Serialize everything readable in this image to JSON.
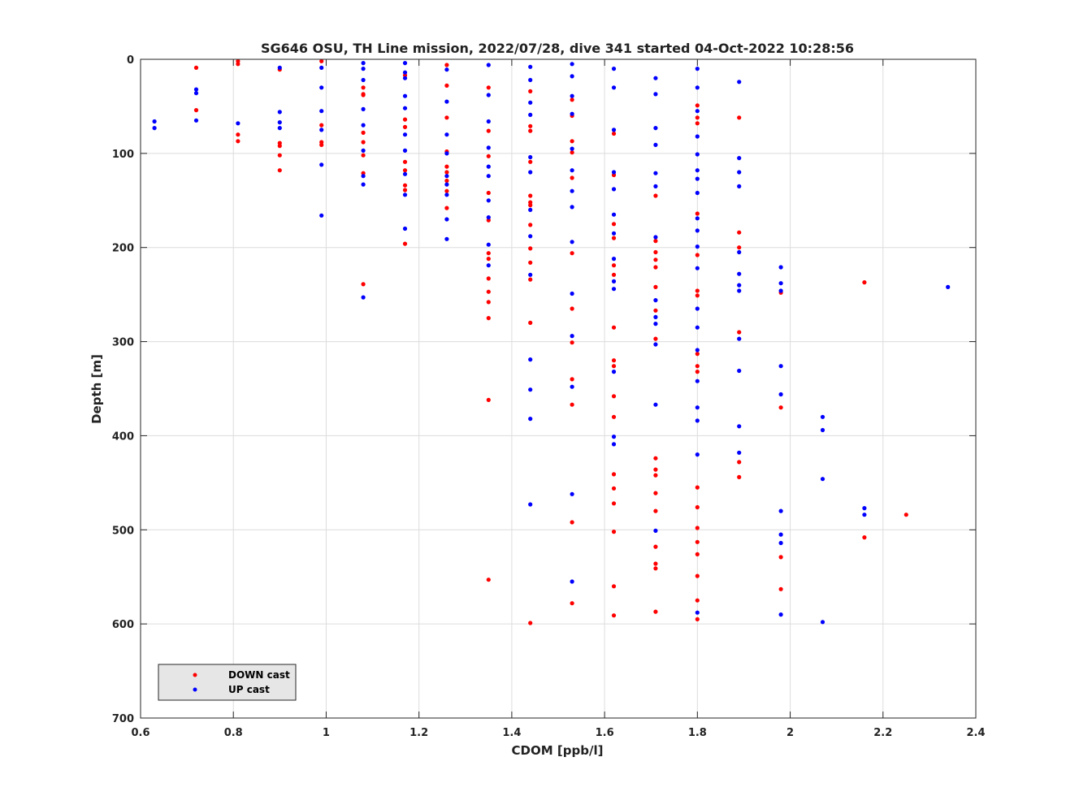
{
  "chart_data": {
    "type": "scatter",
    "title": "SG646 OSU, TH Line mission, 2022/07/28, dive 341 started 04-Oct-2022 10:28:56",
    "xlabel": "CDOM [ppb/l]",
    "ylabel": "Depth [m]",
    "xlim": [
      0.6,
      2.4
    ],
    "ylim": [
      0,
      700
    ],
    "y_reversed": true,
    "grid": true,
    "xticks": [
      0.6,
      0.8,
      1,
      1.2,
      1.4,
      1.6,
      1.8,
      2,
      2.2,
      2.4
    ],
    "xtick_labels": [
      "0.6",
      "0.8",
      "1",
      "1.2",
      "1.4",
      "1.6",
      "1.8",
      "2",
      "2.2",
      "2.4"
    ],
    "yticks": [
      0,
      100,
      200,
      300,
      400,
      500,
      600,
      700
    ],
    "ytick_labels": [
      "0",
      "100",
      "200",
      "300",
      "400",
      "500",
      "600",
      "700"
    ],
    "legend_position": "bottom-left",
    "series": [
      {
        "name": "DOWN cast",
        "color": "#ff0000",
        "x": [
          0.72,
          0.72,
          0.81,
          0.81,
          0.81,
          0.81,
          0.9,
          0.9,
          0.9,
          0.9,
          0.9,
          0.99,
          0.99,
          0.99,
          0.99,
          1.08,
          1.08,
          1.08,
          1.08,
          1.08,
          1.08,
          1.08,
          1.08,
          1.17,
          1.17,
          1.17,
          1.17,
          1.17,
          1.17,
          1.17,
          1.17,
          1.26,
          1.26,
          1.26,
          1.26,
          1.26,
          1.26,
          1.26,
          1.26,
          1.26,
          1.35,
          1.35,
          1.35,
          1.35,
          1.35,
          1.35,
          1.35,
          1.35,
          1.35,
          1.35,
          1.35,
          1.35,
          1.35,
          1.44,
          1.44,
          1.44,
          1.44,
          1.44,
          1.44,
          1.44,
          1.44,
          1.44,
          1.44,
          1.44,
          1.44,
          1.44,
          1.53,
          1.53,
          1.53,
          1.53,
          1.53,
          1.53,
          1.53,
          1.53,
          1.53,
          1.53,
          1.53,
          1.53,
          1.62,
          1.62,
          1.62,
          1.62,
          1.62,
          1.62,
          1.62,
          1.62,
          1.62,
          1.62,
          1.62,
          1.62,
          1.62,
          1.62,
          1.62,
          1.62,
          1.62,
          1.71,
          1.71,
          1.71,
          1.71,
          1.71,
          1.71,
          1.71,
          1.71,
          1.71,
          1.71,
          1.71,
          1.71,
          1.71,
          1.71,
          1.71,
          1.71,
          1.71,
          1.8,
          1.8,
          1.8,
          1.8,
          1.8,
          1.8,
          1.8,
          1.8,
          1.8,
          1.8,
          1.8,
          1.8,
          1.8,
          1.8,
          1.8,
          1.8,
          1.8,
          1.8,
          1.89,
          1.89,
          1.89,
          1.89,
          1.89,
          1.89,
          1.98,
          1.98,
          1.98,
          1.98,
          2.16,
          2.16,
          2.25
        ],
        "y": [
          9,
          54,
          2,
          5,
          80,
          87,
          11,
          89,
          92,
          102,
          118,
          2,
          70,
          88,
          91,
          30,
          38,
          78,
          88,
          102,
          121,
          239,
          37,
          64,
          72,
          109,
          118,
          134,
          139,
          196,
          17,
          28,
          62,
          98,
          114,
          120,
          129,
          140,
          158,
          6,
          30,
          76,
          142,
          171,
          206,
          212,
          233,
          247,
          258,
          275,
          362,
          553,
          103,
          34,
          71,
          109,
          145,
          155,
          176,
          201,
          216,
          234,
          280,
          599,
          152,
          76,
          126,
          206,
          265,
          301,
          340,
          367,
          492,
          578,
          87,
          43,
          60,
          99,
          175,
          190,
          219,
          229,
          285,
          320,
          326,
          358,
          380,
          441,
          456,
          472,
          502,
          560,
          591,
          79,
          123,
          145,
          193,
          205,
          213,
          221,
          242,
          267,
          297,
          424,
          436,
          442,
          461,
          480,
          518,
          536,
          541,
          587,
          49,
          62,
          68,
          164,
          208,
          246,
          251,
          313,
          326,
          332,
          455,
          476,
          498,
          513,
          526,
          549,
          575,
          595,
          62,
          184,
          200,
          290,
          428,
          444,
          248,
          370,
          529,
          563,
          237,
          508,
          484
        ]
      },
      {
        "name": "UP cast",
        "color": "#0000ff",
        "x": [
          0.63,
          0.63,
          0.72,
          0.72,
          0.72,
          0.81,
          0.9,
          0.9,
          0.9,
          0.9,
          0.99,
          0.99,
          0.99,
          0.99,
          0.99,
          0.99,
          1.08,
          1.08,
          1.08,
          1.08,
          1.08,
          1.08,
          1.08,
          1.08,
          1.08,
          1.17,
          1.17,
          1.17,
          1.17,
          1.17,
          1.17,
          1.17,
          1.17,
          1.17,
          1.17,
          1.26,
          1.26,
          1.26,
          1.26,
          1.26,
          1.26,
          1.26,
          1.26,
          1.26,
          1.35,
          1.35,
          1.35,
          1.35,
          1.35,
          1.35,
          1.35,
          1.35,
          1.35,
          1.35,
          1.44,
          1.44,
          1.44,
          1.44,
          1.44,
          1.44,
          1.44,
          1.44,
          1.44,
          1.44,
          1.44,
          1.44,
          1.44,
          1.53,
          1.53,
          1.53,
          1.53,
          1.53,
          1.53,
          1.53,
          1.53,
          1.53,
          1.53,
          1.53,
          1.53,
          1.53,
          1.53,
          1.62,
          1.62,
          1.62,
          1.62,
          1.62,
          1.62,
          1.62,
          1.62,
          1.62,
          1.62,
          1.62,
          1.62,
          1.62,
          1.71,
          1.71,
          1.71,
          1.71,
          1.71,
          1.71,
          1.71,
          1.71,
          1.71,
          1.71,
          1.71,
          1.71,
          1.71,
          1.8,
          1.8,
          1.8,
          1.8,
          1.8,
          1.8,
          1.8,
          1.8,
          1.8,
          1.8,
          1.8,
          1.8,
          1.8,
          1.8,
          1.8,
          1.8,
          1.8,
          1.8,
          1.8,
          1.8,
          1.89,
          1.89,
          1.89,
          1.89,
          1.89,
          1.89,
          1.89,
          1.89,
          1.89,
          1.89,
          1.89,
          1.89,
          1.98,
          1.98,
          1.98,
          1.98,
          1.98,
          1.98,
          1.98,
          1.98,
          1.98,
          2.07,
          2.07,
          2.07,
          2.07,
          2.16,
          2.16,
          2.34
        ],
        "y": [
          66,
          73,
          32,
          36,
          65,
          68,
          9,
          56,
          67,
          73,
          30,
          55,
          75,
          112,
          166,
          9,
          4,
          10,
          22,
          53,
          70,
          97,
          124,
          133,
          253,
          4,
          20,
          39,
          52,
          80,
          97,
          122,
          144,
          14,
          180,
          11,
          45,
          80,
          100,
          124,
          144,
          170,
          191,
          133,
          6,
          38,
          66,
          94,
          114,
          124,
          150,
          168,
          197,
          219,
          8,
          22,
          46,
          59,
          104,
          120,
          160,
          188,
          229,
          319,
          351,
          382,
          473,
          5,
          18,
          39,
          58,
          95,
          118,
          140,
          157,
          194,
          249,
          294,
          348,
          462,
          555,
          10,
          30,
          75,
          120,
          138,
          165,
          185,
          212,
          236,
          244,
          332,
          401,
          409,
          20,
          37,
          73,
          91,
          121,
          135,
          189,
          256,
          274,
          281,
          303,
          367,
          501,
          10,
          30,
          55,
          82,
          101,
          118,
          127,
          142,
          169,
          182,
          199,
          222,
          265,
          285,
          309,
          342,
          370,
          384,
          420,
          588,
          24,
          105,
          120,
          135,
          205,
          228,
          240,
          246,
          297,
          331,
          390,
          418,
          221,
          238,
          246,
          326,
          356,
          480,
          505,
          514,
          590,
          380,
          394,
          446,
          598,
          477,
          484,
          242
        ]
      }
    ]
  }
}
